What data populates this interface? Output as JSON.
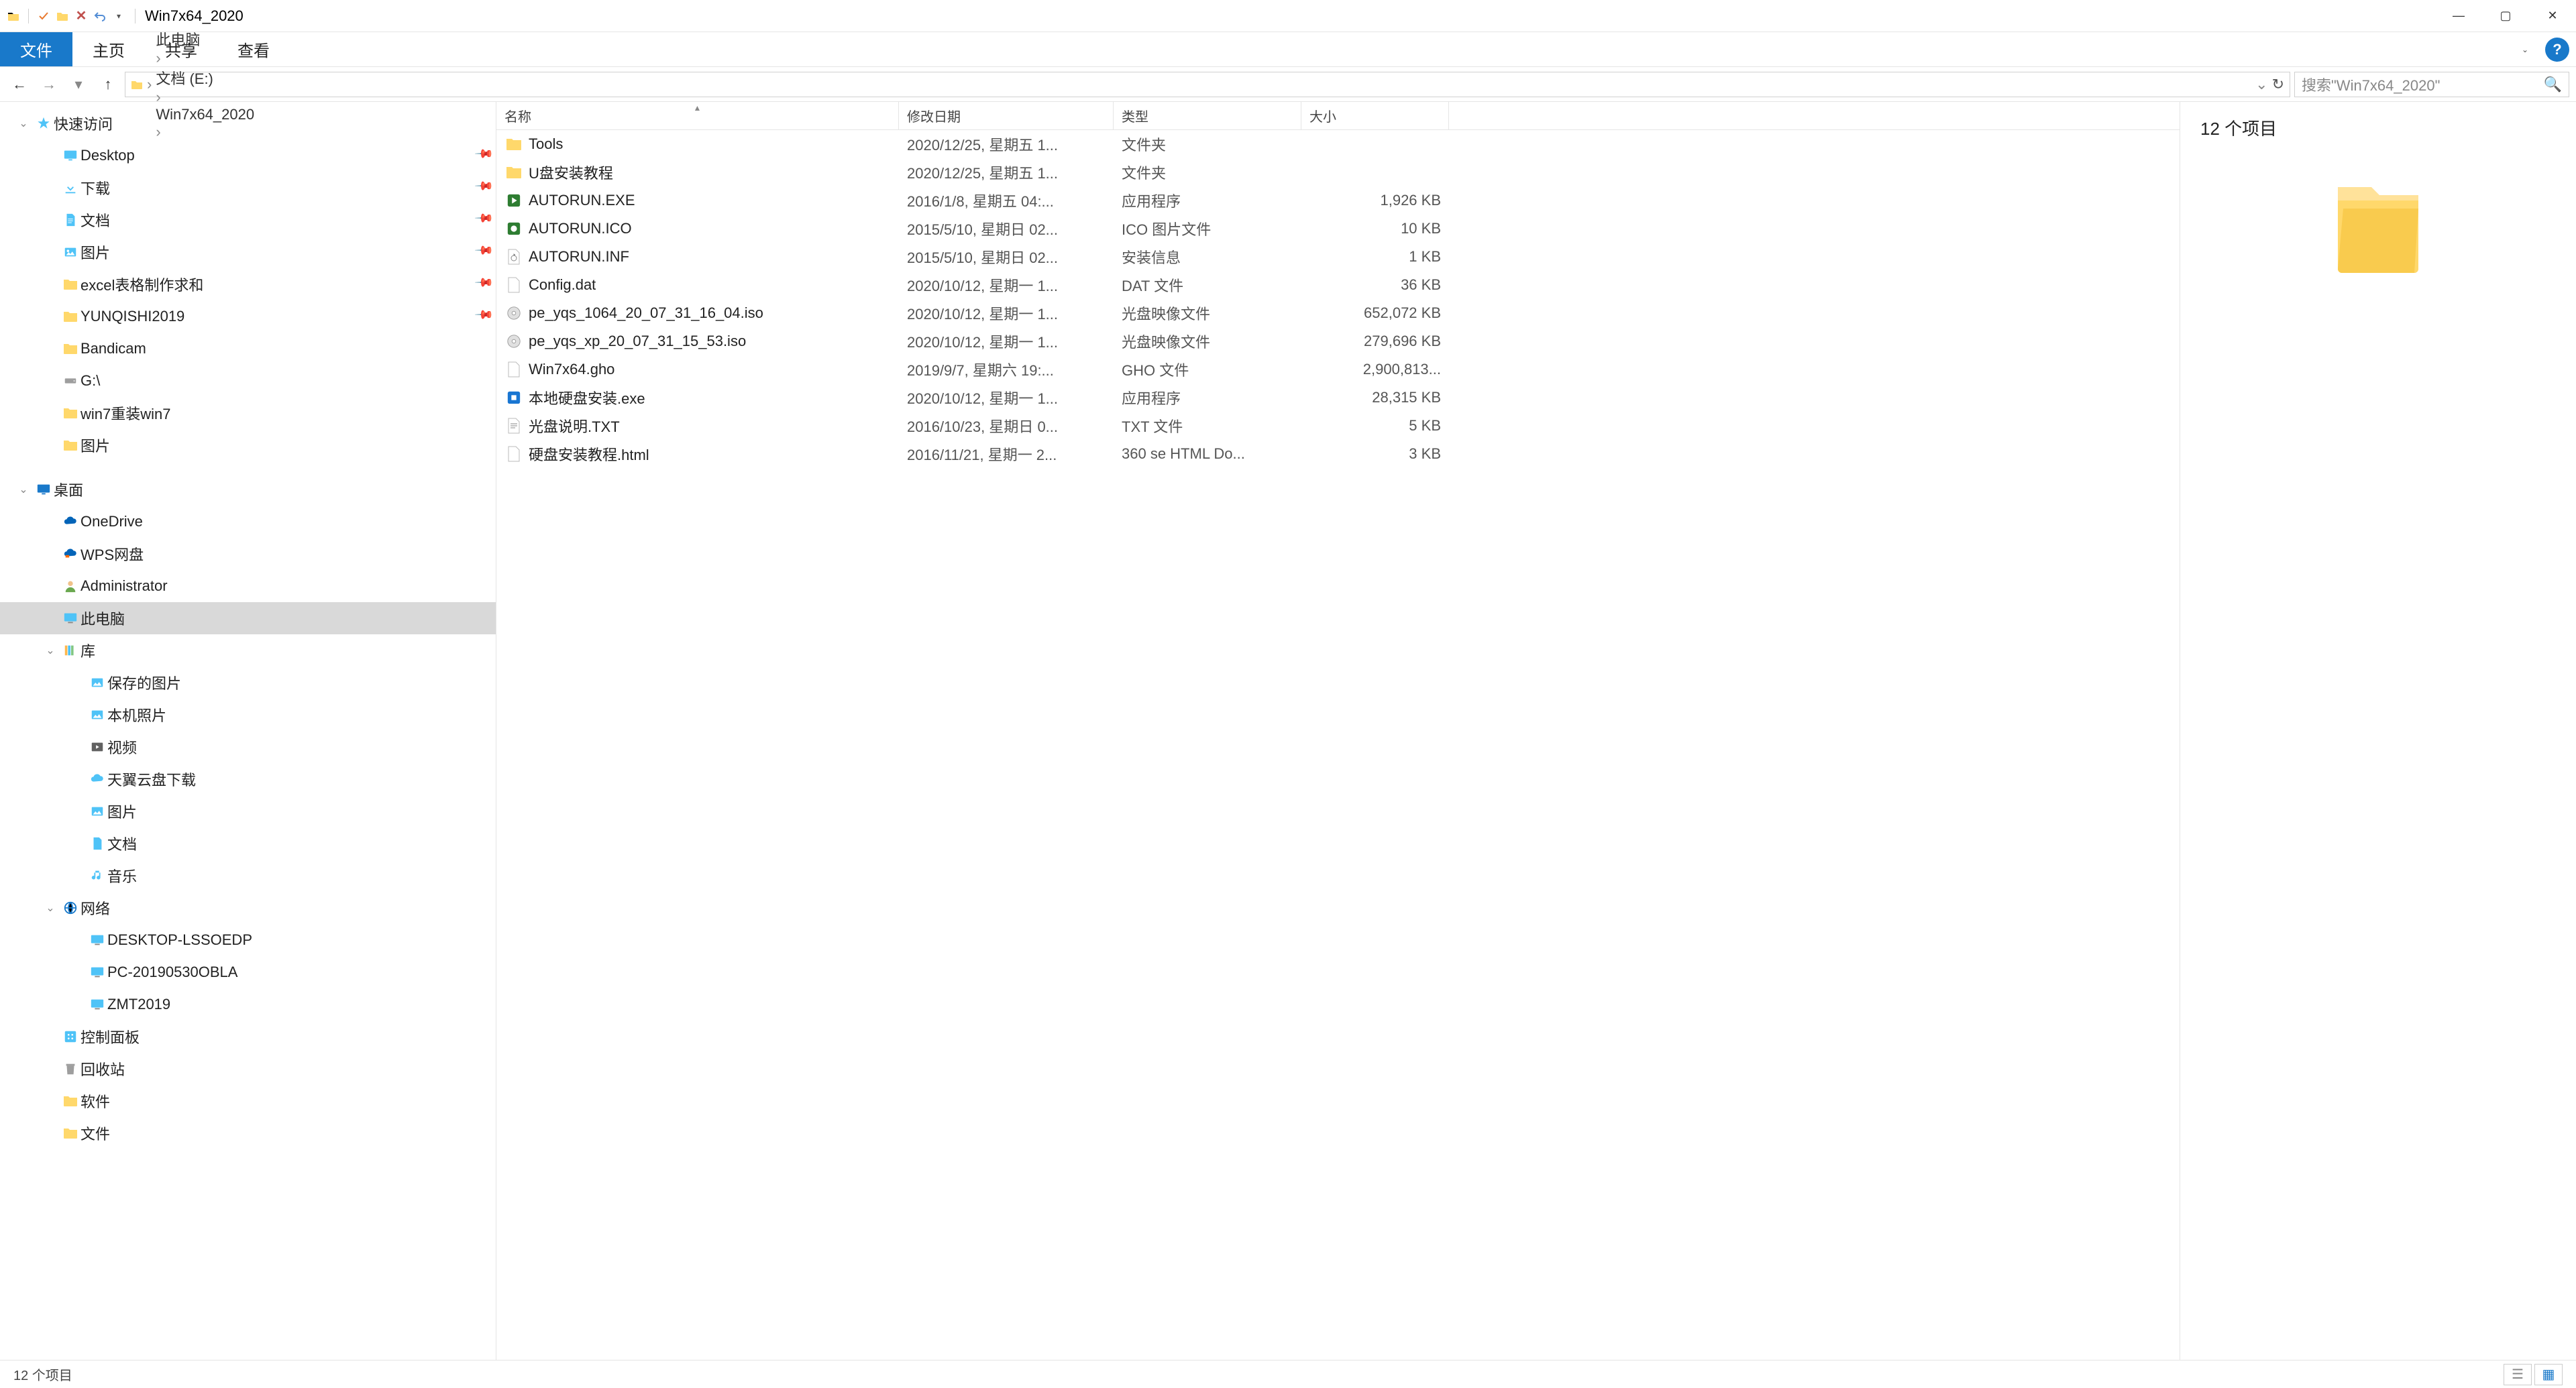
{
  "window": {
    "title": "Win7x64_2020"
  },
  "ribbon": {
    "file": "文件",
    "home": "主页",
    "share": "共享",
    "view": "查看"
  },
  "breadcrumb": [
    {
      "label": "此电脑"
    },
    {
      "label": "文档 (E:)"
    },
    {
      "label": "Win7x64_2020"
    }
  ],
  "search": {
    "placeholder": "搜索\"Win7x64_2020\""
  },
  "nav": [
    {
      "kind": "root",
      "label": "快速访问",
      "icon": "star",
      "expanded": true,
      "indent": 0
    },
    {
      "kind": "item",
      "label": "Desktop",
      "icon": "desktop",
      "pin": true,
      "indent": 1
    },
    {
      "kind": "item",
      "label": "下载",
      "icon": "downloads",
      "pin": true,
      "indent": 1
    },
    {
      "kind": "item",
      "label": "文档",
      "icon": "documents",
      "pin": true,
      "indent": 1
    },
    {
      "kind": "item",
      "label": "图片",
      "icon": "pictures",
      "pin": true,
      "indent": 1
    },
    {
      "kind": "item",
      "label": "excel表格制作求和",
      "icon": "folder",
      "pin": true,
      "indent": 1
    },
    {
      "kind": "item",
      "label": "YUNQISHI2019",
      "icon": "folder",
      "pin": true,
      "indent": 1
    },
    {
      "kind": "item",
      "label": "Bandicam",
      "icon": "folder",
      "indent": 1
    },
    {
      "kind": "item",
      "label": "G:\\",
      "icon": "drive",
      "indent": 1
    },
    {
      "kind": "item",
      "label": "win7重装win7",
      "icon": "folder",
      "indent": 1
    },
    {
      "kind": "item",
      "label": "图片",
      "icon": "folder",
      "indent": 1
    },
    {
      "kind": "gap"
    },
    {
      "kind": "root",
      "label": "桌面",
      "icon": "desktop-root",
      "expanded": true,
      "indent": 0
    },
    {
      "kind": "item",
      "label": "OneDrive",
      "icon": "onedrive",
      "indent": 1
    },
    {
      "kind": "item",
      "label": "WPS网盘",
      "icon": "wps",
      "indent": 1
    },
    {
      "kind": "item",
      "label": "Administrator",
      "icon": "user",
      "indent": 1
    },
    {
      "kind": "item",
      "label": "此电脑",
      "icon": "pc",
      "indent": 1,
      "selected": true
    },
    {
      "kind": "item",
      "label": "库",
      "icon": "library",
      "indent": 1,
      "expanded": true
    },
    {
      "kind": "item",
      "label": "保存的图片",
      "icon": "lib-pic",
      "indent": 2
    },
    {
      "kind": "item",
      "label": "本机照片",
      "icon": "lib-pic",
      "indent": 2
    },
    {
      "kind": "item",
      "label": "视频",
      "icon": "lib-video",
      "indent": 2
    },
    {
      "kind": "item",
      "label": "天翼云盘下载",
      "icon": "lib-cloud",
      "indent": 2
    },
    {
      "kind": "item",
      "label": "图片",
      "icon": "lib-pic",
      "indent": 2
    },
    {
      "kind": "item",
      "label": "文档",
      "icon": "lib-doc",
      "indent": 2
    },
    {
      "kind": "item",
      "label": "音乐",
      "icon": "lib-music",
      "indent": 2
    },
    {
      "kind": "item",
      "label": "网络",
      "icon": "network",
      "indent": 1,
      "expanded": true
    },
    {
      "kind": "item",
      "label": "DESKTOP-LSSOEDP",
      "icon": "netpc",
      "indent": 2
    },
    {
      "kind": "item",
      "label": "PC-20190530OBLA",
      "icon": "netpc",
      "indent": 2
    },
    {
      "kind": "item",
      "label": "ZMT2019",
      "icon": "netpc",
      "indent": 2
    },
    {
      "kind": "item",
      "label": "控制面板",
      "icon": "control",
      "indent": 1
    },
    {
      "kind": "item",
      "label": "回收站",
      "icon": "recycle",
      "indent": 1
    },
    {
      "kind": "item",
      "label": "软件",
      "icon": "folder",
      "indent": 1
    },
    {
      "kind": "item",
      "label": "文件",
      "icon": "folder",
      "indent": 1
    }
  ],
  "columns": {
    "name": "名称",
    "date": "修改日期",
    "type": "类型",
    "size": "大小"
  },
  "files": [
    {
      "name": "Tools",
      "date": "2020/12/25, 星期五 1...",
      "type": "文件夹",
      "size": "",
      "icon": "folder"
    },
    {
      "name": "U盘安装教程",
      "date": "2020/12/25, 星期五 1...",
      "type": "文件夹",
      "size": "",
      "icon": "folder"
    },
    {
      "name": "AUTORUN.EXE",
      "date": "2016/1/8, 星期五 04:...",
      "type": "应用程序",
      "size": "1,926 KB",
      "icon": "exe-green"
    },
    {
      "name": "AUTORUN.ICO",
      "date": "2015/5/10, 星期日 02...",
      "type": "ICO 图片文件",
      "size": "10 KB",
      "icon": "ico"
    },
    {
      "name": "AUTORUN.INF",
      "date": "2015/5/10, 星期日 02...",
      "type": "安装信息",
      "size": "1 KB",
      "icon": "inf"
    },
    {
      "name": "Config.dat",
      "date": "2020/10/12, 星期一 1...",
      "type": "DAT 文件",
      "size": "36 KB",
      "icon": "dat"
    },
    {
      "name": "pe_yqs_1064_20_07_31_16_04.iso",
      "date": "2020/10/12, 星期一 1...",
      "type": "光盘映像文件",
      "size": "652,072 KB",
      "icon": "iso"
    },
    {
      "name": "pe_yqs_xp_20_07_31_15_53.iso",
      "date": "2020/10/12, 星期一 1...",
      "type": "光盘映像文件",
      "size": "279,696 KB",
      "icon": "iso"
    },
    {
      "name": "Win7x64.gho",
      "date": "2019/9/7, 星期六 19:...",
      "type": "GHO 文件",
      "size": "2,900,813...",
      "icon": "gho"
    },
    {
      "name": "本地硬盘安装.exe",
      "date": "2020/10/12, 星期一 1...",
      "type": "应用程序",
      "size": "28,315 KB",
      "icon": "exe-blue"
    },
    {
      "name": "光盘说明.TXT",
      "date": "2016/10/23, 星期日 0...",
      "type": "TXT 文件",
      "size": "5 KB",
      "icon": "txt"
    },
    {
      "name": "硬盘安装教程.html",
      "date": "2016/11/21, 星期一 2...",
      "type": "360 se HTML Do...",
      "size": "3 KB",
      "icon": "html"
    }
  ],
  "preview": {
    "title": "12 个项目"
  },
  "status": {
    "text": "12 个项目"
  }
}
